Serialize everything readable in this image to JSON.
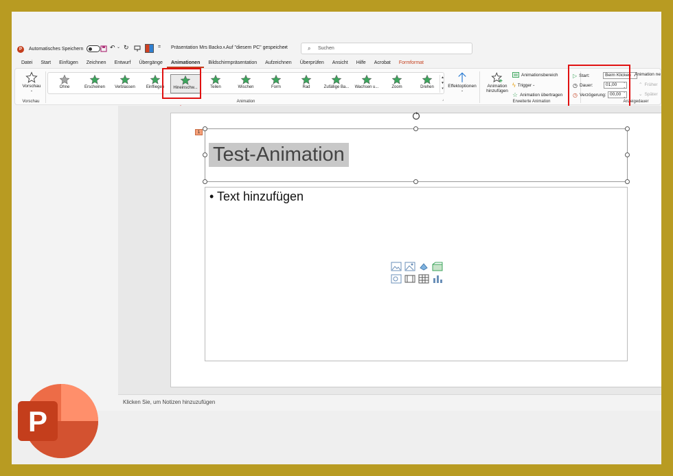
{
  "titlebar": {
    "autosave_label": "Automatisches Speichern",
    "doc_title": "Präsentation Mrs Backo...",
    "save_location": "• Auf \"diesem PC\" gespeichert",
    "search_placeholder": "Suchen",
    "qat_more": "="
  },
  "tabs": [
    {
      "label": "Datei"
    },
    {
      "label": "Start"
    },
    {
      "label": "Einfügen"
    },
    {
      "label": "Zeichnen"
    },
    {
      "label": "Entwurf"
    },
    {
      "label": "Übergänge"
    },
    {
      "label": "Animationen"
    },
    {
      "label": "Bildschirmpräsentation"
    },
    {
      "label": "Aufzeichnen"
    },
    {
      "label": "Überprüfen"
    },
    {
      "label": "Ansicht"
    },
    {
      "label": "Hilfe"
    },
    {
      "label": "Acrobat"
    },
    {
      "label": "Formformat"
    }
  ],
  "ribbon": {
    "preview": {
      "label": "Vorschau",
      "group": "Vorschau"
    },
    "animation_group": "Animation",
    "gallery": [
      {
        "label": "Ohne",
        "color": "#a6a6a6"
      },
      {
        "label": "Erscheinen",
        "color": "#3ca55c"
      },
      {
        "label": "Verblassen",
        "color": "#3ca55c"
      },
      {
        "label": "Einfliegen",
        "color": "#3ca55c"
      },
      {
        "label": "Hineinschw...",
        "color": "#3ca55c"
      },
      {
        "label": "Teilen",
        "color": "#3ca55c"
      },
      {
        "label": "Wischen",
        "color": "#3ca55c"
      },
      {
        "label": "Form",
        "color": "#3ca55c"
      },
      {
        "label": "Rad",
        "color": "#3ca55c"
      },
      {
        "label": "Zufällige Ba...",
        "color": "#3ca55c"
      },
      {
        "label": "Wachsen u...",
        "color": "#3ca55c"
      },
      {
        "label": "Zoom",
        "color": "#3ca55c"
      },
      {
        "label": "Drehen",
        "color": "#3ca55c"
      }
    ],
    "effect_options": "Effektoptionen",
    "add_animation": "Animation hinzufügen",
    "animation_pane": "Animationsbereich",
    "trigger": "Trigger",
    "animation_painter": "Animation übertragen",
    "advanced_group": "Erweiterte Animation",
    "start_label": "Start:",
    "start_value": "Beim Klicken",
    "duration_label": "Dauer:",
    "duration_value": "01,00",
    "delay_label": "Verzögerung:",
    "delay_value": "00,00",
    "timing_group": "Anzeigedauer",
    "reorder_label": "Animation ne",
    "earlier": "Früher",
    "later": "Später"
  },
  "slide": {
    "title": "Test-Animation",
    "body": "• Text hinzufügen",
    "anim_tag": "1"
  },
  "notes_placeholder": "Klicken Sie, um Notizen hinzuzufügen",
  "app_logo_letter": "P"
}
